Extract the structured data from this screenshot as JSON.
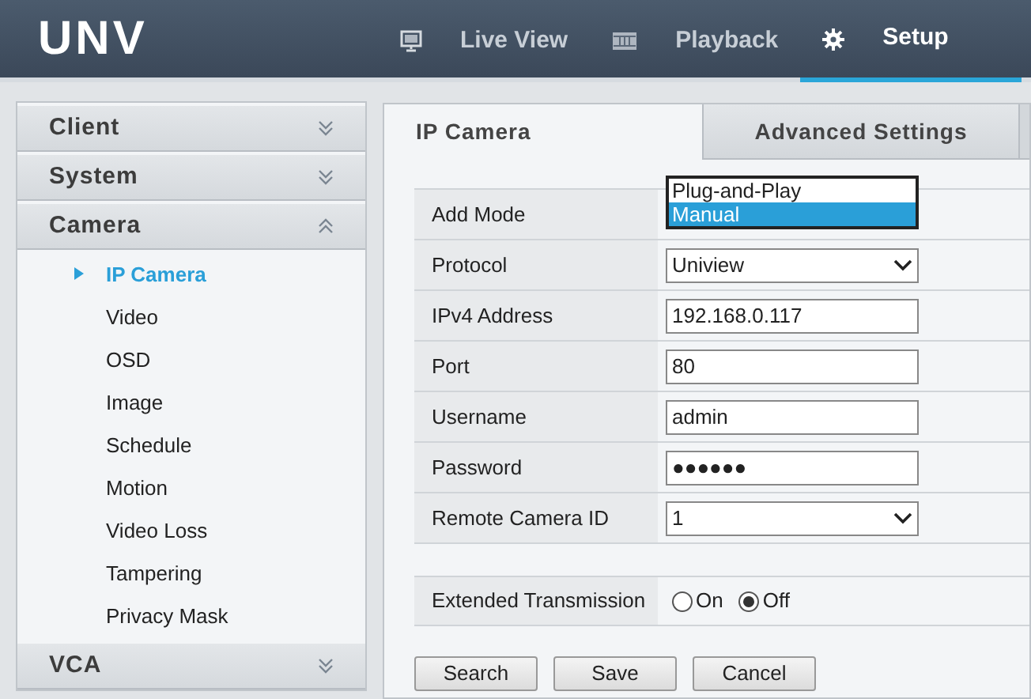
{
  "header": {
    "logo": "UNV",
    "nav": [
      {
        "label": "Live View",
        "kind": "monitor",
        "selected": false
      },
      {
        "label": "Playback",
        "kind": "film",
        "selected": false
      },
      {
        "label": "Setup",
        "kind": "gear",
        "selected": true
      }
    ]
  },
  "sidebar": [
    {
      "label": "Client",
      "expanded": false
    },
    {
      "label": "System",
      "expanded": false
    },
    {
      "label": "Camera",
      "expanded": true,
      "items": [
        {
          "label": "IP Camera",
          "selected": true
        },
        {
          "label": "Video",
          "selected": false
        },
        {
          "label": "OSD",
          "selected": false
        },
        {
          "label": "Image",
          "selected": false
        },
        {
          "label": "Schedule",
          "selected": false
        },
        {
          "label": "Motion",
          "selected": false
        },
        {
          "label": "Video Loss",
          "selected": false
        },
        {
          "label": "Tampering",
          "selected": false
        },
        {
          "label": "Privacy Mask",
          "selected": false
        }
      ]
    },
    {
      "label": "VCA",
      "expanded": false
    }
  ],
  "tabs": [
    {
      "label": "IP Camera",
      "selected": true
    },
    {
      "label": "Advanced Settings",
      "selected": false
    }
  ],
  "form": [
    {
      "label": "Add Mode",
      "kind": "open-list",
      "options": [
        {
          "label": "Plug-and-Play",
          "selected": false
        },
        {
          "label": "Manual",
          "selected": true
        }
      ]
    },
    {
      "label": "Protocol",
      "kind": "select",
      "value": "Uniview"
    },
    {
      "label": "IPv4 Address",
      "kind": "text",
      "value": "192.168.0.117"
    },
    {
      "label": "Port",
      "kind": "text",
      "value": "80"
    },
    {
      "label": "Username",
      "kind": "text",
      "value": "admin"
    },
    {
      "label": "Password",
      "kind": "password",
      "value": "●●●●●●"
    },
    {
      "label": "Remote Camera ID",
      "kind": "select",
      "value": "1"
    }
  ],
  "extended_transmission": {
    "label": "Extended Transmission",
    "options": [
      {
        "label": "On",
        "selected": false
      },
      {
        "label": "Off",
        "selected": true
      }
    ]
  },
  "buttons": [
    "Search",
    "Save",
    "Cancel"
  ]
}
